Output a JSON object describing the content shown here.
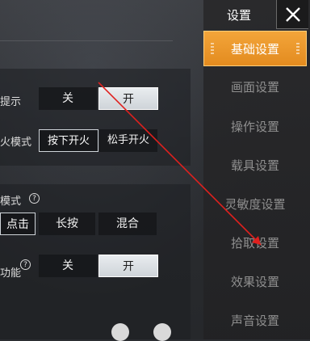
{
  "sidebar": {
    "title": "设置",
    "items": [
      {
        "label": "基础设置",
        "active": true
      },
      {
        "label": "画面设置"
      },
      {
        "label": "操作设置"
      },
      {
        "label": "载具设置"
      },
      {
        "label": "灵敏度设置"
      },
      {
        "label": "拾取设置"
      },
      {
        "label": "效果设置"
      },
      {
        "label": "声音设置"
      }
    ]
  },
  "settings": {
    "row1": {
      "label": "提示",
      "options": [
        "关",
        "开"
      ],
      "selected": "开"
    },
    "row2": {
      "label": "火模式",
      "options": [
        "按下开火",
        "松手开火"
      ],
      "selected": "按下开火"
    },
    "row3": {
      "label": "模式",
      "options": [
        "点击",
        "长按",
        "混合"
      ],
      "selected": "点击"
    },
    "row4": {
      "label": "功能",
      "options": [
        "关",
        "开"
      ],
      "selected": "开"
    }
  },
  "icons": {
    "close": "close-icon",
    "help": "help-icon"
  },
  "colors": {
    "accent": "#e8901f",
    "annotation_line": "#e0201e"
  }
}
